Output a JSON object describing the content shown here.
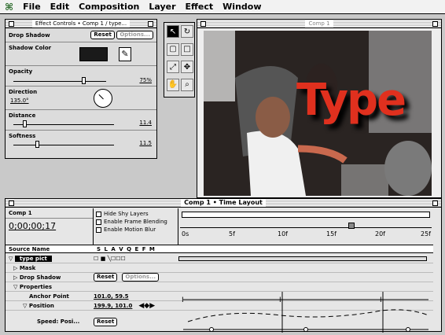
{
  "menu": {
    "apple": "⌘",
    "items": [
      "File",
      "Edit",
      "Composition",
      "Layer",
      "Effect",
      "Window"
    ]
  },
  "effect_panel": {
    "title": "Effect Controls • Comp 1 / type...",
    "effect_name": "Drop Shadow",
    "reset": "Reset",
    "options": "Options...",
    "shadow_color_label": "Shadow Color",
    "shadow_color": "#1a1a1a",
    "opacity_label": "Opacity",
    "opacity_value": "75%",
    "opacity_fraction": 0.75,
    "direction_label": "Direction",
    "direction_value": "135.0°",
    "distance_label": "Distance",
    "distance_value": "11.4",
    "softness_label": "Softness",
    "softness_value": "11.5"
  },
  "tools": [
    "↖",
    "↻",
    "▢",
    "□",
    "⤢",
    "✥",
    "✋",
    "⌕"
  ],
  "comp": {
    "title": "Comp 1",
    "type_text": "Type",
    "type_color": "#e0301e"
  },
  "timeline": {
    "title": "Comp 1 • Time Layout",
    "comp_label": "Comp 1",
    "timecode": "0;00;00;17",
    "options": [
      "Hide Shy Layers",
      "Enable Frame Blending",
      "Enable Motion Blur"
    ],
    "ruler_labels": [
      "0s",
      "5f",
      "10f",
      "15f",
      "20f",
      "25f"
    ],
    "header": {
      "source_name": "Source Name",
      "switches": "S L A V Q E F M"
    },
    "layer_name": "type pict",
    "rows": [
      {
        "label": "Mask"
      },
      {
        "label": "Drop Shadow",
        "value": "Reset",
        "extra": "Options..."
      },
      {
        "label": "Properties"
      },
      {
        "label": "Anchor Point",
        "value": "101.0, 59.5"
      },
      {
        "label": "Position",
        "value": "199.9, 101.0"
      },
      {
        "label": "Speed: Posi...",
        "value": "Reset"
      }
    ]
  }
}
